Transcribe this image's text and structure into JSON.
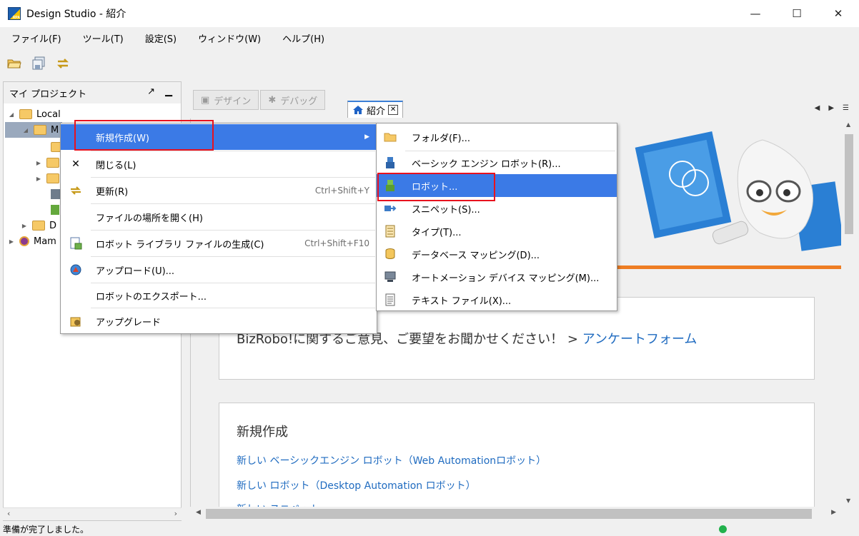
{
  "window": {
    "title": "Design Studio - 紹介",
    "minimize": "—",
    "maximize": "☐",
    "close": "✕"
  },
  "menubar": [
    "ファイル(F)",
    "ツール(T)",
    "設定(S)",
    "ウィンドウ(W)",
    "ヘルプ(H)"
  ],
  "toolbar": {
    "icons": [
      "open-folder-icon",
      "save-all-icon",
      "refresh-icon"
    ]
  },
  "left_panel": {
    "title": "マイ プロジェクト",
    "tree": {
      "local": "Local",
      "selected_partial": "M",
      "partial_d": "D",
      "partial_mam": "Mam"
    }
  },
  "editor": {
    "mode_tabs": [
      "デザイン",
      "デバッグ"
    ],
    "doc_tab": "紹介",
    "survey": {
      "prefix": "BizRobo!に関するご意見、ご要望をお聞かせください！ > ",
      "link": "アンケートフォーム"
    },
    "new_section": {
      "title": "新規作成",
      "links": [
        "新しい ベーシックエンジン ロボット（Web Automationロボット）",
        "新しい ロボット（Desktop Automation ロボット）",
        "新しい スニペット"
      ]
    }
  },
  "context_menu": [
    {
      "label": "新規作成(W)",
      "shortcut": "",
      "icon": "",
      "submenu": true,
      "highlighted": true
    },
    {
      "label": "閉じる(L)",
      "shortcut": "",
      "icon": "close-x-icon"
    },
    {
      "label": "更新(R)",
      "shortcut": "Ctrl+Shift+Y",
      "icon": "refresh-icon"
    },
    {
      "label": "ファイルの場所を開く(H)",
      "shortcut": "",
      "icon": ""
    },
    {
      "label": "ロボット ライブラリ ファイルの生成(C)",
      "shortcut": "Ctrl+Shift+F10",
      "icon": "library-file-icon"
    },
    {
      "label": "アップロード(U)...",
      "shortcut": "",
      "icon": "upload-icon"
    },
    {
      "label": "ロボットのエクスポート...",
      "shortcut": "",
      "icon": ""
    },
    {
      "label": "アップグレード",
      "shortcut": "",
      "icon": "upgrade-icon"
    }
  ],
  "sub_menu": [
    {
      "label": "フォルダ(F)...",
      "icon": "folder-icon"
    },
    {
      "label": "ベーシック エンジン ロボット(R)...",
      "icon": "basic-robot-icon"
    },
    {
      "label": "ロボット...",
      "icon": "robot-icon",
      "highlighted": true
    },
    {
      "label": "スニペット(S)...",
      "icon": "snippet-icon"
    },
    {
      "label": "タイプ(T)...",
      "icon": "type-icon"
    },
    {
      "label": "データベース マッピング(D)...",
      "icon": "database-icon"
    },
    {
      "label": "オートメーション デバイス マッピング(M)...",
      "icon": "device-mapping-icon"
    },
    {
      "label": "テキスト ファイル(X)...",
      "icon": "text-file-icon"
    }
  ],
  "status": {
    "text": "準備が完了しました。"
  },
  "colors": {
    "highlight": "#3b7ae6",
    "accent_orange": "#ee7d23",
    "link": "#1f6bc0",
    "annotation_red": "#e8121e"
  }
}
